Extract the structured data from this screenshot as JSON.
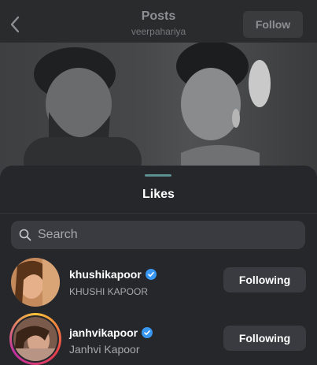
{
  "header": {
    "title": "Posts",
    "subtitle": "veerpahariya",
    "follow_label": "Follow"
  },
  "sheet": {
    "title": "Likes",
    "search_placeholder": "Search"
  },
  "likes": [
    {
      "username": "khushikapoor",
      "full_name": "KHUSHI KAPOOR",
      "verified": true,
      "button_label": "Following",
      "has_story_ring": false
    },
    {
      "username": "janhvikapoor",
      "full_name": "Janhvi Kapoor",
      "verified": true,
      "button_label": "Following",
      "has_story_ring": true
    }
  ],
  "colors": {
    "verified_blue": "#3897f0",
    "handle": "#5b8f90"
  }
}
